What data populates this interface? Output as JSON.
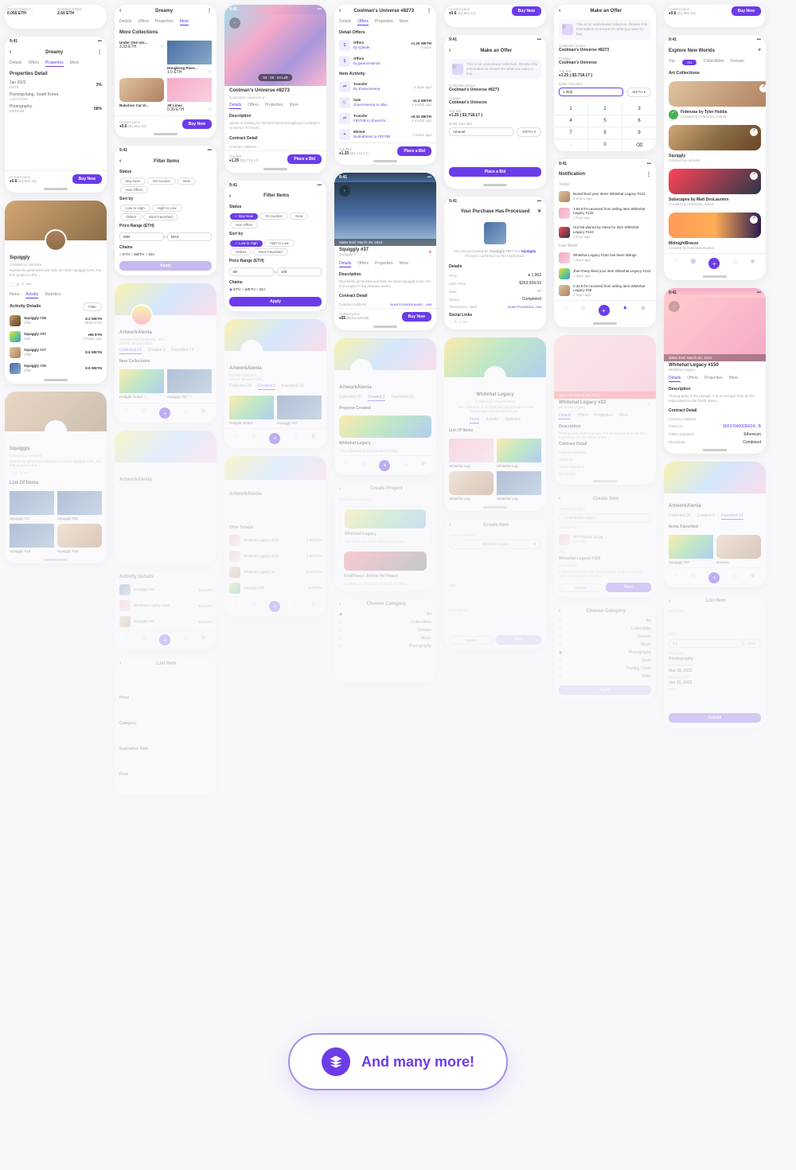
{
  "statusbar_time": "9:41",
  "buy_now": "Buy Now",
  "place_bid": "Place a Bid",
  "more_banner": "And many more!",
  "col1": {
    "p1": {
      "card1_title": "Soccer Doge #...",
      "card1_price": "0.055 ETH",
      "card2_title": "Invaders #3556",
      "card2_price": "2.50 ETH"
    },
    "p2": {
      "title": "Dreamy",
      "tabs": [
        "Details",
        "Offers",
        "Properties",
        "More"
      ],
      "prop_title": "Properties Detail",
      "r1_l": "Jan 2022",
      "r1_s": "DATE",
      "r1_v": "3%",
      "r2_l": "Pyeongchang, South Korea",
      "r2_s": "LOCATION",
      "r3_l": "Photography",
      "r3_s": "MEDIUM",
      "r3_v": "58%",
      "price_lbl": "Current price",
      "price": "0.6",
      "price_sub": "($1,961.16)"
    },
    "p3": {
      "name": "Squiggly",
      "creator": "Created by nshooks",
      "desc": "Randomly generated and fully on-chain squiggly lines, the first project in the...",
      "tabs": [
        "Items",
        "Activity",
        "Statistics"
      ],
      "activity_title": "Activity Details",
      "filter": "Filter",
      "a1_name": "Squiggly #18",
      "a1_type": "Offer",
      "a1_val": "8.3 WETH",
      "a1_eth": "+$903 ETH",
      "a2_name": "Squiggly #37",
      "a2_type": "Sale",
      "a2_val": "65 ETH",
      "a2_eth": "2 hours ago",
      "a3_name": "Squiggly #17",
      "a3_type": "Offer",
      "a3_val": "8.5 WETH",
      "a4_name": "Squiggly #19",
      "a4_type": "Offer",
      "a4_val": "8.5 WETH"
    },
    "p4": {
      "name": "Squiggly",
      "creator": "Created by nshooks",
      "tab": "List Of Items",
      "i1": "Squiggly #37",
      "i2": "Squiggly #30",
      "i3": "Squiggly #19",
      "i4": "Squiggly #19"
    }
  },
  "col2": {
    "p1": {
      "title": "Dreamy",
      "tabs": [
        "Details",
        "Offers",
        "Properties",
        "More"
      ],
      "more_title": "More Collections",
      "c1_name": "Under One Uni...",
      "c1_price": "3.33 ETH",
      "c2_name": "Hongkong Pave...",
      "c2_price": "1.0 ETH",
      "c3_name": "Bukchon Cat Vi...",
      "c4_name": "JR Lines",
      "c4_price": "0.39 ETH",
      "price_lbl": "Current price",
      "price": "0.6",
      "price_sub": "($1,961.16)"
    },
    "p2": {
      "title": "Filter Items",
      "status": "Status",
      "s1": "Buy Now",
      "s2": "On Auction",
      "s3": "New",
      "s4": "Has Offers",
      "sortby": "Sort by",
      "o1": "Low to High",
      "o2": "High to Low",
      "o3": "Oldest",
      "o4": "Most Favorited",
      "prange": "Price Range (ETH)",
      "min": "MIN",
      "max": "MAX",
      "to": "to",
      "chains": "Chains",
      "c1": "ETH",
      "c2": "WETH",
      "c3": "DIA",
      "apply": "Apply"
    },
    "p3": {
      "name": "ArtworkAlenia",
      "handle": "0x7e59703EofeABodo...053",
      "joined": "Joined January 2021",
      "tabs": [
        "Collected 24",
        "Created 2",
        "Favorited 12"
      ],
      "sec": "Item Collections",
      "i1": "Hedgila #2353",
      "i2": "Squiggly #37"
    },
    "p4": {
      "name": "ArtworkAlenia"
    },
    "p5": {
      "name": "ArtworkAlenia",
      "act": "Activity Details",
      "a1": "Squiggly #19",
      "a1v": "0.6 ETH",
      "a2": "Whitehat Legacy #122",
      "a2v": "0.6 ETH",
      "a3": "Squiggly #30",
      "a3v": "0.8 ETH"
    },
    "p6": {
      "title": "List Item",
      "price": "Price",
      "cat": "Category",
      "exp": "Expiration Date",
      "fees": "Fees"
    }
  },
  "col3": {
    "p1": {
      "timestamp": "02 : 05 : 04 Left",
      "name": "Coolman's Universe #8273",
      "creator": "Coolman's Universe",
      "tabs": [
        "Details",
        "Offers",
        "Properties",
        "More"
      ],
      "desc_title": "Description",
      "desc": "Spesh is looking for his best friend throughout Coolman's Universe. To travel...",
      "contract_title": "Contract Detail",
      "contract_addr": "Contract Address",
      "topbid_lbl": "Top Bid",
      "topbid": "1.25",
      "topbid_sub": "($3,718.17)"
    },
    "p2": {
      "title": "Filter Items",
      "status": "Status",
      "s1": "Buy Now",
      "s2": "On Auction",
      "s3": "New",
      "s4": "Has Offers",
      "sortby": "Sort by",
      "o1": "Low to High",
      "o2": "High to Low",
      "o3": "Oldest",
      "o4": "Most Favorited",
      "prange": "Price Range (ETH)",
      "min": "80",
      "max": "100",
      "to": "to",
      "chains": "Chains",
      "c1": "ETH",
      "c2": "WETH",
      "c3": "DIA",
      "apply": "Apply"
    },
    "p3": {
      "name": "ArtworkAlenia",
      "handle": "0x7e59703EofeA...",
      "joined": "Joined January 2021",
      "tabs": [
        "Collected 24",
        "Created 0",
        "Favorited 12"
      ],
      "i1": "Hedgila #2352",
      "i2": "Squiggly #37"
    },
    "p4": {
      "name": "ArtworkAlenia",
      "offer_title": "Offer Details",
      "o1": "Whitehat Legacy #122",
      "o1v": "1.55 ETH",
      "o2": "Whitehat Legacy #122",
      "o2v": "1.50 ETH",
      "o3": "Whitehat Legacy #1",
      "o3v": "8.15 ETH",
      "o4": "Squiggly #30",
      "o4v": "3.5 ETH"
    }
  },
  "col4": {
    "p1": {
      "title": "Coolman's Universe #8273",
      "tabs": [
        "Details",
        "Offers",
        "Properties",
        "More"
      ],
      "detail_offers": "Detail Offers",
      "off_name": "Offers",
      "off_val": "1.25 WETH",
      "off_by": "by vj3Iude",
      "off_time": "4 days",
      "off2_by": "by gwoncmain24",
      "item_activity": "Item Activity",
      "tr1_name": "Transfer",
      "tr1_by": "by JhoenJmerna",
      "tr1_time": "4 days ago",
      "sale_name": "Sale",
      "sale_by": "JhoenJmerna to 4dw...",
      "sale_val": "1.4 WETH",
      "sale_time": "4 month ago",
      "tr2_name": "Transfer",
      "tr2_by": "F8274B to JhoenJm...",
      "tr2_val": "0.33 WETH",
      "tr2_time": "4 month ago",
      "mint_name": "Minted",
      "mint_by": "NullAddress to F8274B",
      "mint_time": "2 hours ago",
      "topbid_lbl": "Top Bid",
      "topbid": "1.25",
      "topbid_sub": "($3,718.17)"
    },
    "p2": {
      "timestamp": "Sales End: March 28, 2022",
      "name": "Squiggly #37",
      "coll": "Squiggly",
      "tabs": [
        "Details",
        "Offers",
        "Properties",
        "More"
      ],
      "desc_t": "Description",
      "desc": "Randomly generated and fully on-chain squiggly lines, the first project in the Atlantes series.",
      "contract_t": "Contract Detail",
      "contract_a": "Contract Address",
      "contract_v": "0x36F379400DE6c6BC...d98",
      "price_lbl": "Current price",
      "price": "65",
      "price_sub": "($193,949.08)"
    },
    "p3": {
      "name": "ArtworkAlenia",
      "tabs": [
        "Collected 20",
        "Created 2",
        "Favorited 12"
      ],
      "proj_t": "Projects Created",
      "p1_name": "Whitehat Legacy",
      "p1_desc": "This collection of 24 selected photogr..."
    },
    "p4": {
      "title": "Create Project",
      "choose": "Choose your project",
      "wl": "Whitehat Legacy",
      "wl_desc": "The collection of 24 collected photogr...",
      "fp": "FindPeace: Artists for Peace",
      "fp_desc": "FindPeace: Artists for Peace is a collab..."
    },
    "p5": {
      "title": "Choose Category",
      "c1": "Art",
      "c2": "Collectibles",
      "c3": "Domain",
      "c4": "Music",
      "c5": "Photography"
    }
  },
  "col5": {
    "p1": {
      "price_lbl": "Current price",
      "price": "0.6",
      "price_sub": "($1,961.16)"
    },
    "p2": {
      "title": "Make an Offer",
      "warn": "This is an unreviewed collection. Review this information to ensure it's what you want to buy.",
      "cn_lbl": "Collection Name",
      "cn": "Coolman's Universe #8273",
      "cr_lbl": "Creator",
      "cr": "Coolman's Universe",
      "tb_lbl": "Top Bid",
      "tb": "1.25 ( $3,718.17 )",
      "eyb_lbl": "Enter Your Bid",
      "amount": "Amount",
      "weth": "WETH"
    },
    "p3": {
      "title": "Your Purchase Has Processed",
      "msg": "You just purchased for Squiggly #37 from Squiggly. It's been confirmed on the blockchain.",
      "details_t": "Details",
      "price_l": "Price",
      "price_v": "1,962",
      "usd_l": "USD Price",
      "usd_v": "$263,594.59",
      "date_l": "Date",
      "date_v": "—",
      "st_l": "Status",
      "st_v": "Completed",
      "tx_l": "Transaction Hash",
      "tx_v": "0x36F379400DE6...d98",
      "sl_t": "Social Links"
    },
    "p4": {
      "name": "Whitehat Legacy",
      "creator": "Created by ArtworkAlenia",
      "desc": "This collection of 24 selected photographs is the homecage and declaration of...",
      "tabs": [
        "Items",
        "Activity",
        "Statistics"
      ],
      "list_t": "List Of Items",
      "i1": "Whitehat Leg...",
      "i2": "Whitehat Leg...",
      "i3": "Whitehat Leg...",
      "i4": "Whitehat Leg..."
    },
    "p5": {
      "title": "Create Item",
      "sp": "Selected Project",
      "sp_v": "Whitehat Legacy",
      "title_l": "Title",
      "desc_l": "Description",
      "cancel": "Cancel",
      "next": "Next"
    }
  },
  "col6": {
    "p1": {
      "title": "Make an Offer",
      "warn": "This is an unreviewed collection. Review this information to ensure it's what you want to buy.",
      "cn_lbl": "Collection Name",
      "cn": "Coolman's Universe #8273",
      "cr_lbl": "Creator",
      "cr": "Coolman's Universe",
      "tb_lbl": "Top Bid",
      "tb": "1.25 ( $3,718.17 )",
      "eyb_lbl": "Enter Your Bid",
      "bid": "1.362",
      "weth": "WETH",
      "keys": [
        "1",
        "2",
        "3",
        "4",
        "5",
        "6",
        "7",
        "8",
        "9",
        ".",
        "0",
        "⌫"
      ]
    },
    "p2": {
      "title": "Notification",
      "today": "Today",
      "n1": "Bored liked your items Whitehat Legacy #122",
      "n1_t": "2 hours ago",
      "n2": "1.56 ETH received from selling item Whitehat Legacy #122",
      "n2_t": "1 hour ago",
      "n3": "Hot bid placed by Alexa for item Whitehat Legacy #122",
      "n3_t": "1 hour ago",
      "lastweek": "Last Week",
      "n4": "Whitehat Legacy #150 has been listings",
      "n4_t": "1 days ago",
      "n5": "JhenTreey liked your item Whitehat Legacy #122",
      "n5_t": "1 days ago",
      "n6": "0.33 ETH received from selling item Whitehat Legacy #38",
      "n6_t": "2 days ago"
    },
    "p3": {
      "timestamp": "Sale Out: March 22, 2021",
      "name": "Whitehat Legacy #22",
      "coll": "Whitehat Legacy",
      "tabs": [
        "Details",
        "Offers",
        "Properties",
        "More"
      ],
      "desc_t": "Description",
      "desc": "Photography is life escape. It is an escape from all the expectation to the finish draws...",
      "contract_t": "Contract Detail",
      "addr_l": "Contract Address",
      "tid_l": "Token ID",
      "tstd_l": "Token Standard",
      "bc_l": "Blockchain"
    },
    "p4": {
      "title": "Create Item",
      "sp": "Selected Project",
      "sp_v": "Whitehat Legacy",
      "up": "Upload File",
      "up_type": "NFT Picture 18.jpg",
      "up_size": "35.4 KB",
      "title_l": "Title",
      "title_v": "Whitehat Legacy #150",
      "desc_l": "Description",
      "desc_v": "It about two years after the landslide of the canal first raise you stayed. A brutal...",
      "cancel": "Cancel",
      "next": "Next"
    },
    "p5": {
      "title": "Choose Category",
      "c1": "Art",
      "c2": "Collectibles",
      "c3": "Domain",
      "c4": "Music",
      "c5": "Photography",
      "c6": "Sport",
      "c7": "Trading Cards",
      "c8": "Utility"
    }
  },
  "col7": {
    "p1": {
      "price_lbl": "Current price",
      "price": "0.6",
      "price_sub": "($1,961.16)"
    },
    "p2": {
      "title": "Explore New Worlds",
      "tabs": [
        "Top",
        "Art",
        "Collectibles",
        "Domain"
      ],
      "sec": "Art Collections",
      "c1_name": "Fidenzas by Tyler Hobbs",
      "c1_by": "Created by ArtBlocks_Admin",
      "c2_name": "Squiggly",
      "c2_by": "Created by nshooks",
      "c3_name": "Subscapes by Matt DesLauriers",
      "c3_by": "Created by ArtBlocks_Admin",
      "c4_name": "MidnightBreeze",
      "c4_by": "Created by DutchtideStudios"
    },
    "p3": {
      "timestamp": "Sales End: March 28, 2022",
      "name": "Whitehat Legacy #150",
      "coll": "Whitehat Legacy",
      "tabs": [
        "Details",
        "Offers",
        "Properties",
        "More"
      ],
      "desc_t": "Description",
      "desc": "Photography is life escape. It is an escape from all the expectation to the finish draws...",
      "contract_t": "Contract Detail",
      "addr_l": "Contract Address",
      "tid_l": "Token ID",
      "tid_v": "36F379400DE624...B",
      "tstd_l": "Token Standard",
      "tstd_v": "Ethereum",
      "bc_l": "Blockchain",
      "bc_v": "Combined"
    },
    "p4": {
      "name": "ArtworkAlenia",
      "tabs": [
        "Collected 20",
        "Created 2",
        "Favorited 12"
      ],
      "sec": "Items Favorited",
      "i1": "Squiggly #37",
      "i2": "Dreamy"
    },
    "p5": {
      "title": "List Item",
      "lp": "List Price",
      "price": "Price",
      "amt": "0.6",
      "unit": "ETH",
      "cat": "Category",
      "cat_v": "Photography",
      "exp": "Expiration Date",
      "exp_v": "Mar 28, 2022",
      "sd": "Starting Date",
      "sd_v": "Jan 25, 2022",
      "fees": "Fees",
      "submit": "Submit"
    }
  }
}
